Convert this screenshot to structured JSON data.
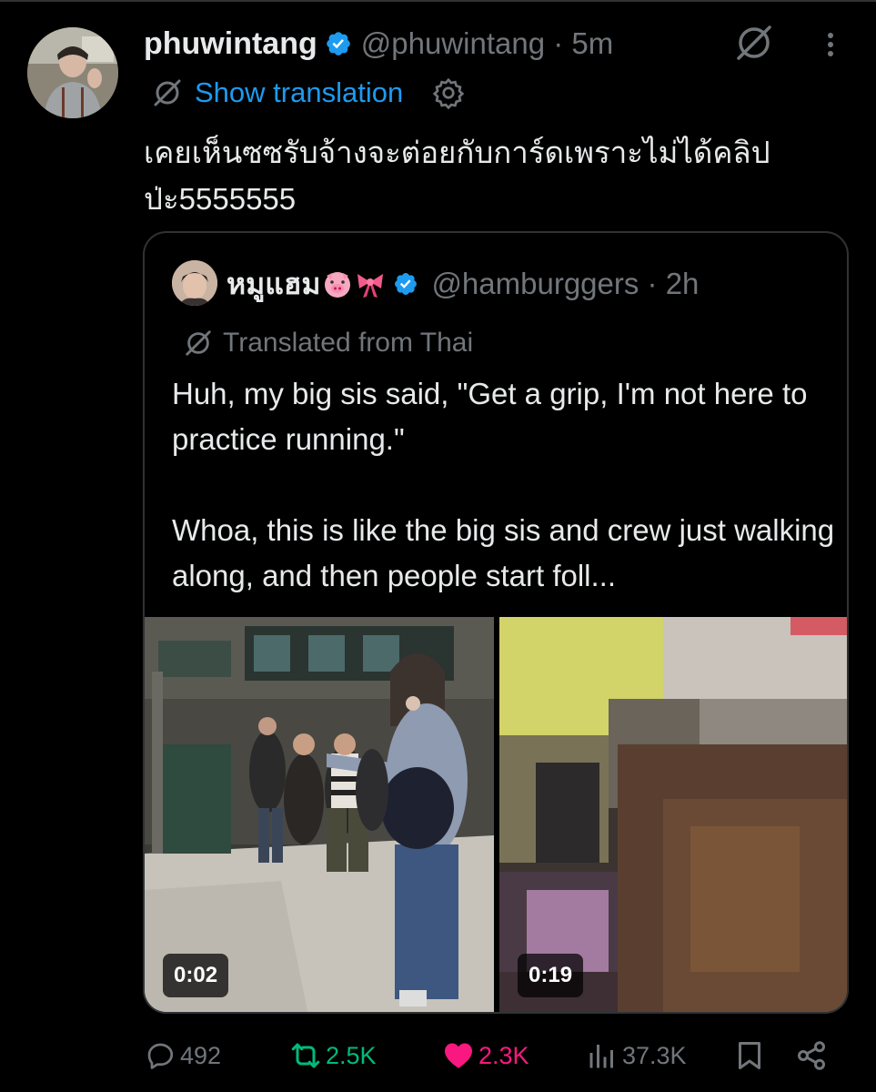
{
  "post": {
    "author_name": "phuwintang",
    "handle_time": "@phuwintang · 5m",
    "show_translation_label": "Show translation",
    "text": "เคยเห็นซซรับจ้างจะต่อยกับการ์ดเพราะไม่ได้คลิป\nป่ะ5555555"
  },
  "quoted_post": {
    "author_name": "หมูแฮม",
    "handle_time": "@hamburggers · 2h",
    "translated_label": "Translated from Thai",
    "text": "Huh, my big sis said, \"Get a grip, I'm not here to practice running.\"\n\nWhoa, this is like the big sis and crew just walking along, and then people start foll...",
    "videos": [
      {
        "duration": "0:02"
      },
      {
        "duration": "0:19"
      }
    ]
  },
  "actions": {
    "replies": "492",
    "reposts": "2.5K",
    "likes": "2.3K",
    "views": "37.3K"
  },
  "colors": {
    "background": "#000000",
    "text": "#e7e9ea",
    "muted": "#71767b",
    "link": "#1d9bf0",
    "verified": "#1d9bf0",
    "repost": "#00ba7c",
    "like": "#f91880",
    "border": "#2f3336"
  },
  "icons": [
    "verified-badge-icon",
    "grok-icon",
    "more-icon",
    "translate-icon",
    "settings-icon",
    "pig-emoji-icon",
    "ribbon-emoji-icon",
    "reply-icon",
    "repost-icon",
    "like-icon",
    "views-icon",
    "bookmark-icon",
    "share-icon"
  ]
}
